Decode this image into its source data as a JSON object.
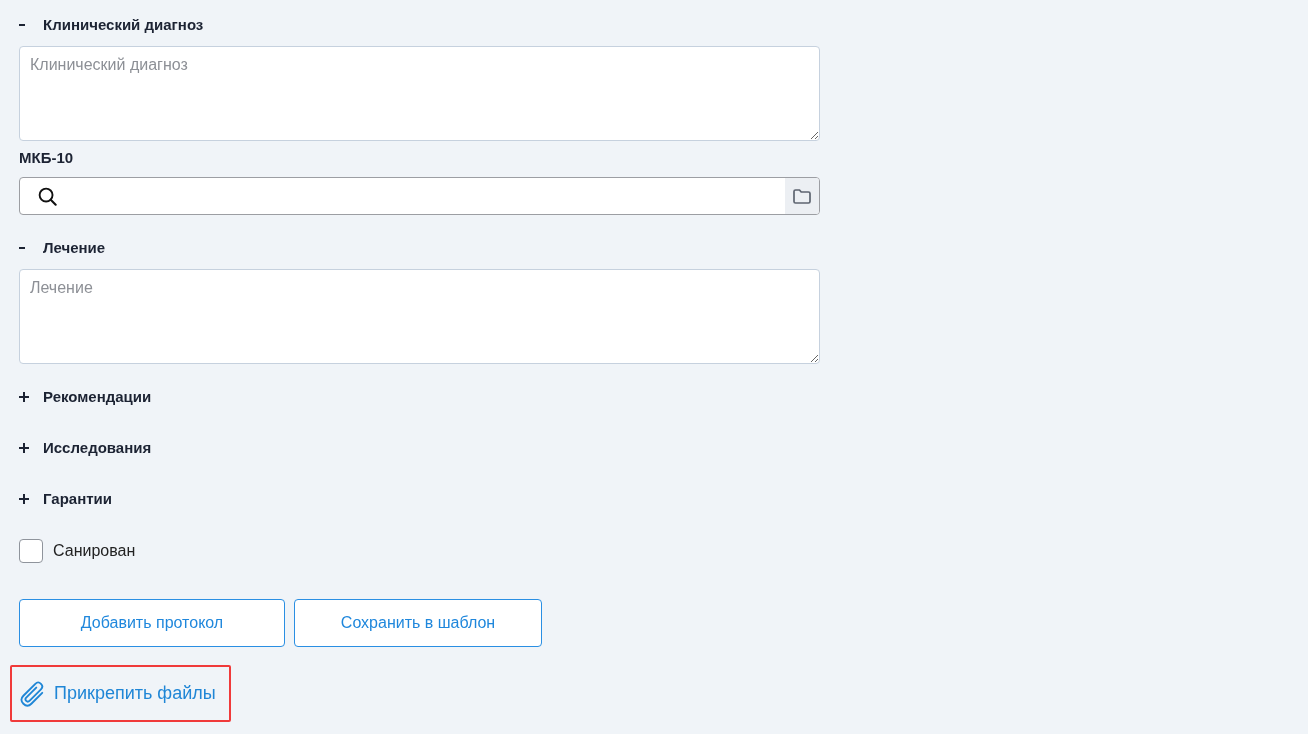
{
  "sections": [
    {
      "expanded": true,
      "title": "Клинический диагноз",
      "textarea": {
        "placeholder": "Клинический диагноз"
      },
      "code_field": {
        "label": "МКБ-10"
      }
    },
    {
      "expanded": true,
      "title": "Лечение",
      "textarea": {
        "placeholder": "Лечение"
      }
    },
    {
      "expanded": false,
      "title": "Рекомендации"
    },
    {
      "expanded": false,
      "title": "Исследования"
    },
    {
      "expanded": false,
      "title": "Гарантии"
    }
  ],
  "sanitized_checkbox": {
    "label": "Санирован",
    "checked": false
  },
  "buttons": [
    {
      "label": "Добавить протокол"
    },
    {
      "label": "Сохранить в шаблон"
    }
  ],
  "attach_link": {
    "label": "Прикрепить файлы",
    "highlighted": true
  }
}
